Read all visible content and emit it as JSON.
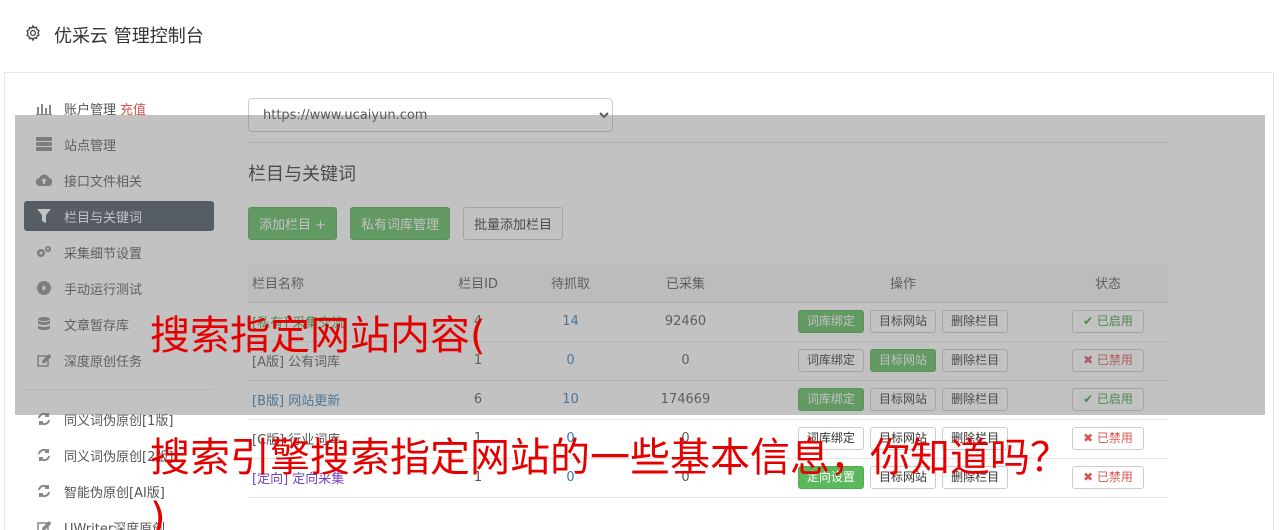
{
  "header": {
    "title": "优采云 管理控制台",
    "icon": "gear-icon"
  },
  "sidebar": {
    "items": [
      {
        "label": "账户管理",
        "extra": "充值",
        "icon": "bar-chart-icon"
      },
      {
        "label": "站点管理",
        "icon": "server-icon"
      },
      {
        "label": "接口文件相关",
        "icon": "cloud-upload-icon"
      },
      {
        "label": "栏目与关键词",
        "icon": "filter-icon",
        "active": true
      },
      {
        "label": "采集细节设置",
        "icon": "cogs-icon"
      },
      {
        "label": "手动运行测试",
        "icon": "play-circle-icon"
      },
      {
        "label": "文章暂存库",
        "icon": "database-icon"
      },
      {
        "label": "深度原创任务",
        "icon": "edit-icon"
      },
      {
        "label": "同义词伪原创[1版]",
        "icon": "refresh-icon"
      },
      {
        "label": "同义词伪原创[2版]",
        "icon": "refresh-icon"
      },
      {
        "label": "智能伪原创[AI版]",
        "icon": "refresh-icon"
      },
      {
        "label": "UWriter深度原创",
        "icon": "edit-icon"
      }
    ]
  },
  "main": {
    "site_select": {
      "value": "https://www.ucaiyun.com"
    },
    "section_title": "栏目与关键词",
    "buttons": {
      "add_column": "添加栏目 +",
      "private_lib": "私有词库管理",
      "batch_add": "批量添加栏目"
    },
    "table": {
      "headers": [
        "栏目名称",
        "栏目ID",
        "待抓取",
        "已采集",
        "操作",
        "状态"
      ],
      "rows": [
        {
          "name": "[私有] 采集交流",
          "id": "4",
          "pending": "14",
          "collected": "92460",
          "op1": "词库绑定",
          "op2": "目标网站",
          "op3": "删除栏目",
          "status": "✔ 已启用"
        },
        {
          "name": "[A版] 公有词库",
          "id": "1",
          "pending": "0",
          "collected": "0",
          "op1": "词库绑定",
          "op2": "目标网站",
          "op3": "删除栏目",
          "status": "✖ 已禁用"
        },
        {
          "name": "[B版] 网站更新",
          "id": "6",
          "pending": "10",
          "collected": "174669",
          "op1": "词库绑定",
          "op2": "目标网站",
          "op3": "删除栏目",
          "status": "✔ 已启用"
        },
        {
          "name": "[C版] 行业词库",
          "id": "1",
          "pending": "0",
          "collected": "0",
          "op1": "词库绑定",
          "op2": "目标网站",
          "op3": "删除栏目",
          "status": "✖ 已禁用"
        },
        {
          "name": "[定向] 定向采集",
          "id": "1",
          "pending": "0",
          "collected": "0",
          "op1": "定向设置",
          "op2": "目标网站",
          "op3": "删除栏目",
          "status": "✖ 已禁用"
        }
      ]
    }
  },
  "overlay": {
    "line1": "搜索指定网站内容(",
    "line2": "搜索引擎搜索指定网站的一些基本信息，你知道吗？",
    "line3": ")"
  }
}
